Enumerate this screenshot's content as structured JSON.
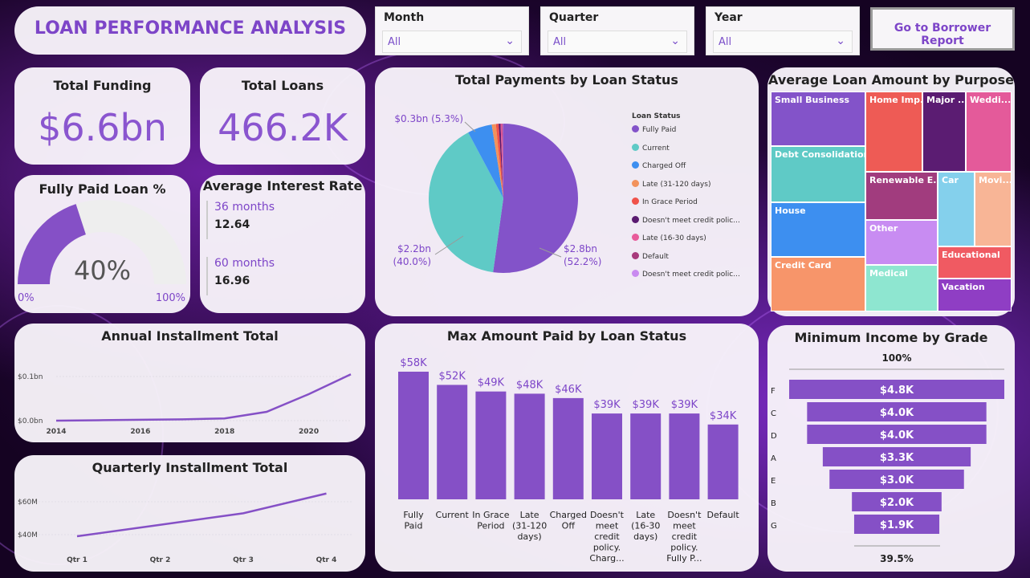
{
  "header": {
    "title": "LOAN PERFORMANCE ANALYSIS"
  },
  "slicers": [
    {
      "label": "Month",
      "value": "All"
    },
    {
      "label": "Quarter",
      "value": "All"
    },
    {
      "label": "Year",
      "value": "All"
    }
  ],
  "nav_button": "Go to Borrower Report",
  "kpis": {
    "total_funding": {
      "label": "Total Funding",
      "value": "$6.6bn"
    },
    "total_loans": {
      "label": "Total Loans",
      "value": "466.2K"
    }
  },
  "gauge": {
    "title": "Fully Paid Loan %",
    "value_label": "40%",
    "value": 0.4,
    "min": "0%",
    "max": "100%"
  },
  "interest": {
    "title": "Average Interest Rate",
    "rows": [
      {
        "term": "36 months",
        "rate": "12.64"
      },
      {
        "term": "60 months",
        "rate": "16.96"
      }
    ]
  },
  "colors": {
    "accent": "#8a55cf",
    "bar": "#8550c6"
  },
  "chart_data": [
    {
      "id": "pie",
      "type": "pie",
      "title": "Total Payments by Loan Status",
      "legend_title": "Loan Status",
      "legend_position": "right",
      "slices": [
        {
          "name": "Fully Paid",
          "value": 52.2,
          "color": "#8353c9",
          "label": "$2.8bn (52.2%)"
        },
        {
          "name": "Current",
          "value": 40.0,
          "color": "#5fcac6",
          "label": "$2.2bn (40.0%)"
        },
        {
          "name": "Charged Off",
          "value": 5.3,
          "color": "#3d8ff0",
          "label": "$0.3bn (5.3%)"
        },
        {
          "name": "Late (31-120 days)",
          "value": 0.9,
          "color": "#f2925c",
          "label": ""
        },
        {
          "name": "In Grace Period",
          "value": 0.6,
          "color": "#f0524a",
          "label": ""
        },
        {
          "name": "Doesn't meet credit polic...",
          "value": 0.4,
          "color": "#5a1a70",
          "label": ""
        },
        {
          "name": "Late (16-30 days)",
          "value": 0.3,
          "color": "#e85b9a",
          "label": ""
        },
        {
          "name": "Default",
          "value": 0.2,
          "color": "#a83a7c",
          "label": ""
        },
        {
          "name": "Doesn't meet credit polic...",
          "value": 0.1,
          "color": "#c98af0",
          "label": ""
        }
      ]
    },
    {
      "id": "treemap",
      "type": "treemap",
      "title": "Average Loan Amount by Purpose",
      "items": [
        {
          "name": "Small Business",
          "color": "#8353c9"
        },
        {
          "name": "Debt Consolidation",
          "color": "#5fcac6"
        },
        {
          "name": "House",
          "color": "#3d8ff0"
        },
        {
          "name": "Credit Card",
          "color": "#f7956a"
        },
        {
          "name": "Home Imp...",
          "color": "#ee5b55"
        },
        {
          "name": "Major ...",
          "color": "#5b1c72"
        },
        {
          "name": "Weddi...",
          "color": "#e45a9a"
        },
        {
          "name": "Renewable E...",
          "color": "#a13c7e"
        },
        {
          "name": "Other",
          "color": "#c88cf2"
        },
        {
          "name": "Medical",
          "color": "#8ee6d0"
        },
        {
          "name": "Car",
          "color": "#84d0ec"
        },
        {
          "name": "Movi...",
          "color": "#f8b596"
        },
        {
          "name": "Educational",
          "color": "#f05a62"
        },
        {
          "name": "Vacation",
          "color": "#8f3ec4"
        }
      ]
    },
    {
      "id": "annual",
      "type": "line",
      "title": "Annual Installment Total",
      "x": [
        2014,
        2015,
        2016,
        2017,
        2018,
        2019,
        2020,
        2021
      ],
      "y": [
        0.0,
        0.001,
        0.002,
        0.003,
        0.005,
        0.02,
        0.06,
        0.105
      ],
      "x_ticks": [
        "2014",
        "2016",
        "2018",
        "2020"
      ],
      "y_ticks": [
        "$0.0bn",
        "$0.1bn"
      ],
      "ylim": [
        0,
        0.1
      ]
    },
    {
      "id": "quarterly",
      "type": "line",
      "title": "Quarterly Installment Total",
      "categories": [
        "Qtr 1",
        "Qtr 2",
        "Qtr 3",
        "Qtr 4"
      ],
      "values": [
        39,
        46,
        53,
        65
      ],
      "y_ticks": [
        "$40M",
        "$60M"
      ],
      "ylim": [
        40,
        60
      ]
    },
    {
      "id": "maxpaid",
      "type": "bar",
      "title": "Max Amount Paid by Loan Status",
      "categories": [
        "Fully Paid",
        "Current",
        "In Grace Period",
        "Late (31-120 days)",
        "Charged Off",
        "Doesn't meet credit policy. Charg...",
        "Late (16-30 days)",
        "Doesn't meet credit policy. Fully P...",
        "Default"
      ],
      "cat_lines": [
        [
          "Fully",
          "Paid"
        ],
        [
          "Current"
        ],
        [
          "In Grace",
          "Period"
        ],
        [
          "Late",
          "(31-120",
          "days)"
        ],
        [
          "Charged",
          "Off"
        ],
        [
          "Doesn't",
          "meet",
          "credit",
          "policy.",
          "Charg..."
        ],
        [
          "Late",
          "(16-30",
          "days)"
        ],
        [
          "Doesn't",
          "meet",
          "credit",
          "policy.",
          "Fully P..."
        ],
        [
          "Default"
        ]
      ],
      "values": [
        58,
        52,
        49,
        48,
        46,
        39,
        39,
        39,
        34
      ],
      "labels": [
        "$58K",
        "$52K",
        "$49K",
        "$48K",
        "$46K",
        "$39K",
        "$39K",
        "$39K",
        "$34K"
      ],
      "ylim": [
        0,
        60
      ]
    },
    {
      "id": "funnel",
      "type": "bar",
      "title": "Minimum Income by Grade",
      "categories": [
        "F",
        "C",
        "D",
        "A",
        "E",
        "B",
        "G"
      ],
      "values": [
        4.8,
        4.0,
        4.0,
        3.3,
        3.0,
        2.0,
        1.9
      ],
      "labels": [
        "$4.8K",
        "$4.0K",
        "$4.0K",
        "$3.3K",
        "$3.0K",
        "$2.0K",
        "$1.9K"
      ],
      "top_label": "100%",
      "bottom_label": "39.5%"
    }
  ]
}
